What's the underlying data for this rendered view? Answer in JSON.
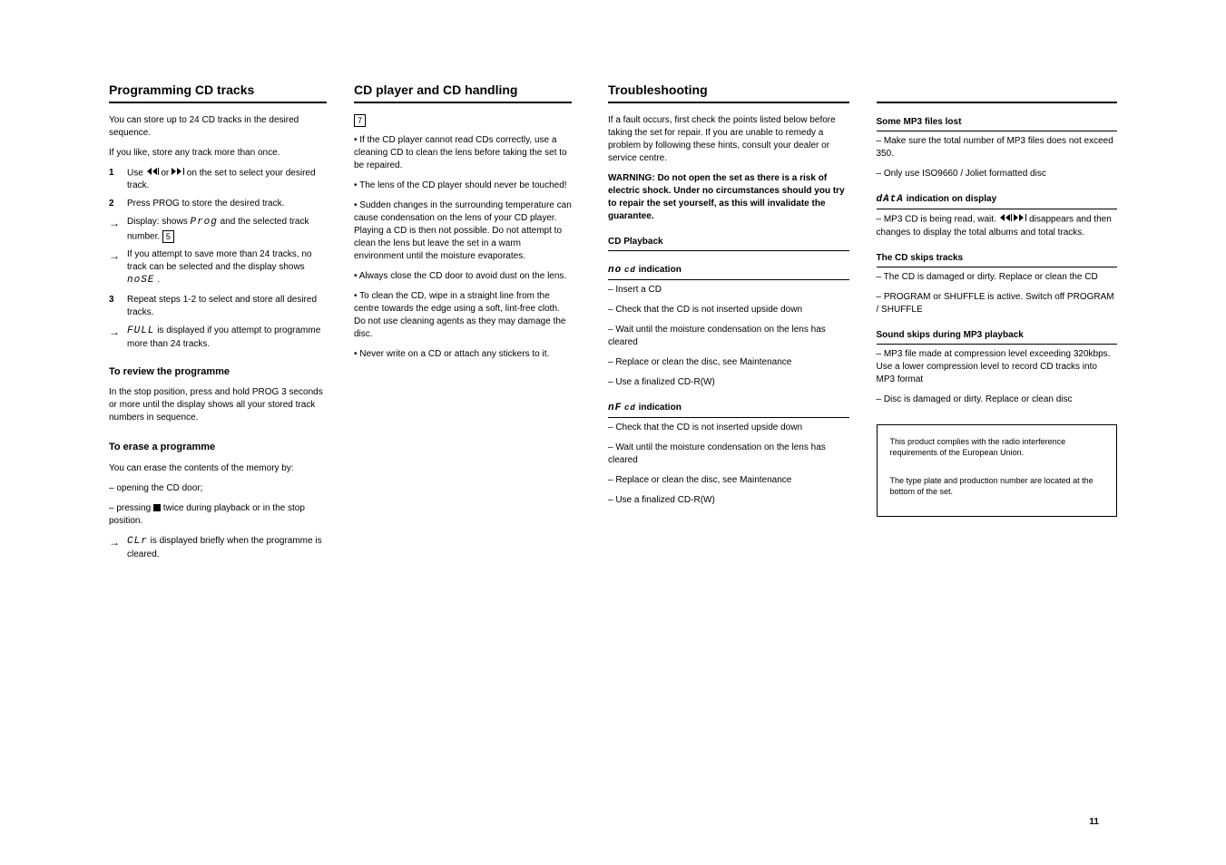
{
  "col1": {
    "heading": "Programming CD tracks",
    "intro1": "You can store up to 24 CD tracks in the desired sequence.",
    "intro2": "If you like, store any track more than once.",
    "step1_label": "1",
    "step1": "Use ",
    "step1_b": " or ",
    "step1_c": " on the set to select your desired track.",
    "step2_label": "2",
    "step2": "Press PROG to store the desired track.",
    "arrow1": "Display: shows ",
    "arrow1_lcd": "Prog",
    "arrow1_b": " and the selected track number. ",
    "arrow1_keycap": "5",
    "arrow2": "If you attempt to save more than 24 tracks, no track can be selected and the display shows ",
    "arrow2_lcd": "noSE",
    "arrow2_b": ".",
    "step3_label": "3",
    "step3": "Repeat steps 1-2 to select and store all desired tracks.",
    "arrow3_lcd": "FULL",
    "arrow3": " is displayed if you attempt to programme more than 24 tracks.",
    "review_h": "To review the programme",
    "review_p": "In the stop position, press and hold PROG 3 seconds or more until the display shows all your stored track numbers in sequence.",
    "erase_h": "To erase a programme",
    "erase_p": "You can erase the contents of the memory by:",
    "erase_b1": "– opening the CD door;",
    "erase_b2": "– pressing ",
    "erase_b2b": " twice during playback or in the stop position.",
    "arrow4_lcd": "CLr",
    "arrow4": " is displayed briefly when the programme is cleared."
  },
  "col2": {
    "heading": "CD player and CD handling",
    "keycap7": "7",
    "b1": "If the CD player cannot read CDs correctly, use a cleaning CD to clean the lens before taking the set to be repaired.",
    "b2": "The lens of the CD player should never be touched!",
    "b3": "Sudden changes in the surrounding temperature can cause condensation on the lens of your CD player. Playing a CD is then not possible. Do not attempt to clean the lens but leave the set in a warm environment until the moisture evaporates.",
    "b4": "Always close the CD door to avoid dust on the lens.",
    "b5": "To clean the CD, wipe in a straight line from the centre towards the edge using a soft, lint-free cloth. Do not use cleaning agents as they may damage the disc.",
    "b6": "Never write on a CD or attach any stickers to it."
  },
  "col3": {
    "heading": "Troubleshooting",
    "intro": "If a fault occurs, first check the points listed below before taking the set for repair. If you are unable to remedy a problem by following these hints, consult your dealer or service centre.",
    "warn": "WARNING: Do not open the set as there is a risk of electric shock. Under no circumstances should you try to repair the set yourself, as this will invalidate the guarantee.",
    "cd_h": "CD Playback",
    "nodisc_h_lcd": "no",
    "nodisc_h_lcd2": "cd",
    "nodisc_h_txt": " indication",
    "nodisc_b1": "– Insert a CD",
    "nodisc_b2": "– Check that the CD is not inserted upside down",
    "nodisc_b3": "– Wait until the moisture condensation on the lens has cleared",
    "nodisc_b4": "– Replace or clean the disc, see Maintenance",
    "nodisc_b5": "– Use a finalized CD-R(W)",
    "nf_h_lcd": "nF",
    "nf_h_lcd2": "cd",
    "nf_h_txt": " indication",
    "nf_b1": "– Check that the CD is not inserted upside down",
    "nf_b2": "– Wait until the moisture condensation on the lens has cleared",
    "nf_b3": "– Replace or clean the disc, see Maintenance",
    "nf_b4": "– Use a finalized CD-R(W)"
  },
  "col4": {
    "heading_blank": "",
    "mp3_h": "Some MP3 files lost",
    "mp3_b1": "– Make sure the total number of MP3 files does not exceed 350.",
    "mp3_b2": "– Only use ISO9660 / Joliet formatted disc",
    "data_h_lcd": "dAtA",
    "data_h_txt": " indication on display",
    "data_b1": "– MP3 CD is being read, wait. ",
    "data_b1b": " disappears and then changes to display the total albums and total tracks.",
    "cdskip_h": "The CD skips tracks",
    "cdskip_b1": "– The CD is damaged or dirty. Replace or clean the CD",
    "cdskip_b2": "– PROGRAM or SHUFFLE is active. Switch off PROGRAM / SHUFFLE",
    "mp3skip_h": "Sound skips during MP3 playback",
    "mp3skip_b1": "– MP3 file made at compression level exceeding 320kbps. Use a lower compression level to record CD tracks into MP3 format",
    "mp3skip_b2": "– Disc is damaged or dirty. Replace or clean disc",
    "note_h": "",
    "note_p1": "This product complies with the radio interference requirements of the European Union.",
    "note_p2": "The type plate and production number are located at the bottom of the set.",
    "page_num": "11"
  },
  "icons": {
    "prev": "prev-track-icon",
    "next": "next-track-icon",
    "stop": "stop-icon"
  }
}
